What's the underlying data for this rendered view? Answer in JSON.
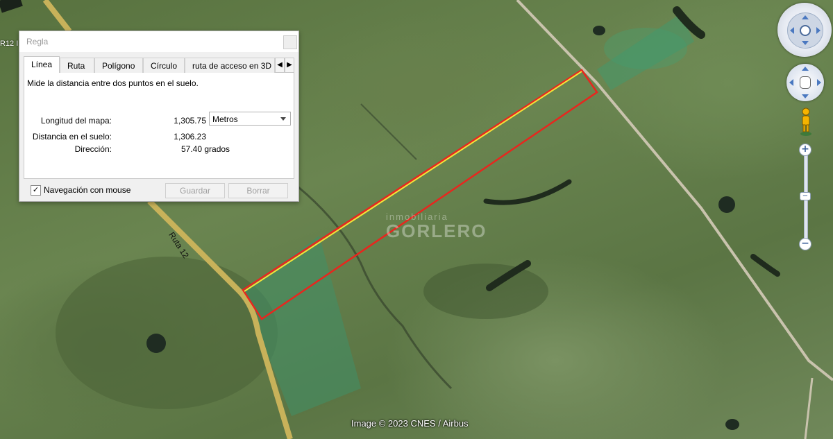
{
  "map": {
    "road_label": "Ruta 12",
    "corner_label": "R12 I",
    "watermark_top": "inmobiliaria",
    "watermark_main": "GORLERO",
    "credit": "Image © 2023 CNES / Airbus"
  },
  "dialog": {
    "title": "Regla",
    "tabs": [
      "Línea",
      "Ruta",
      "Polígono",
      "Círculo",
      "ruta de acceso en 3D"
    ],
    "active_tab": "Línea",
    "description": "Mide la distancia entre dos puntos en el suelo.",
    "map_length_label": "Longitud del mapa:",
    "map_length_value": "1,305.75",
    "unit_selected": "Metros",
    "ground_distance_label": "Distancia en el suelo:",
    "ground_distance_value": "1,306.23",
    "direction_label": "Dirección:",
    "direction_value": "57.40 grados",
    "mouse_nav_label": "Navegación con mouse",
    "mouse_nav_checked": true,
    "save_label": "Guardar",
    "clear_label": "Borrar"
  },
  "navigation": {
    "zoom_in": "+",
    "zoom_out": "−",
    "zoom_thumb": "−"
  },
  "colors": {
    "measure_line": "#f2e23a",
    "parcel_outline": "#e8261e",
    "road": "#c8b25a"
  }
}
